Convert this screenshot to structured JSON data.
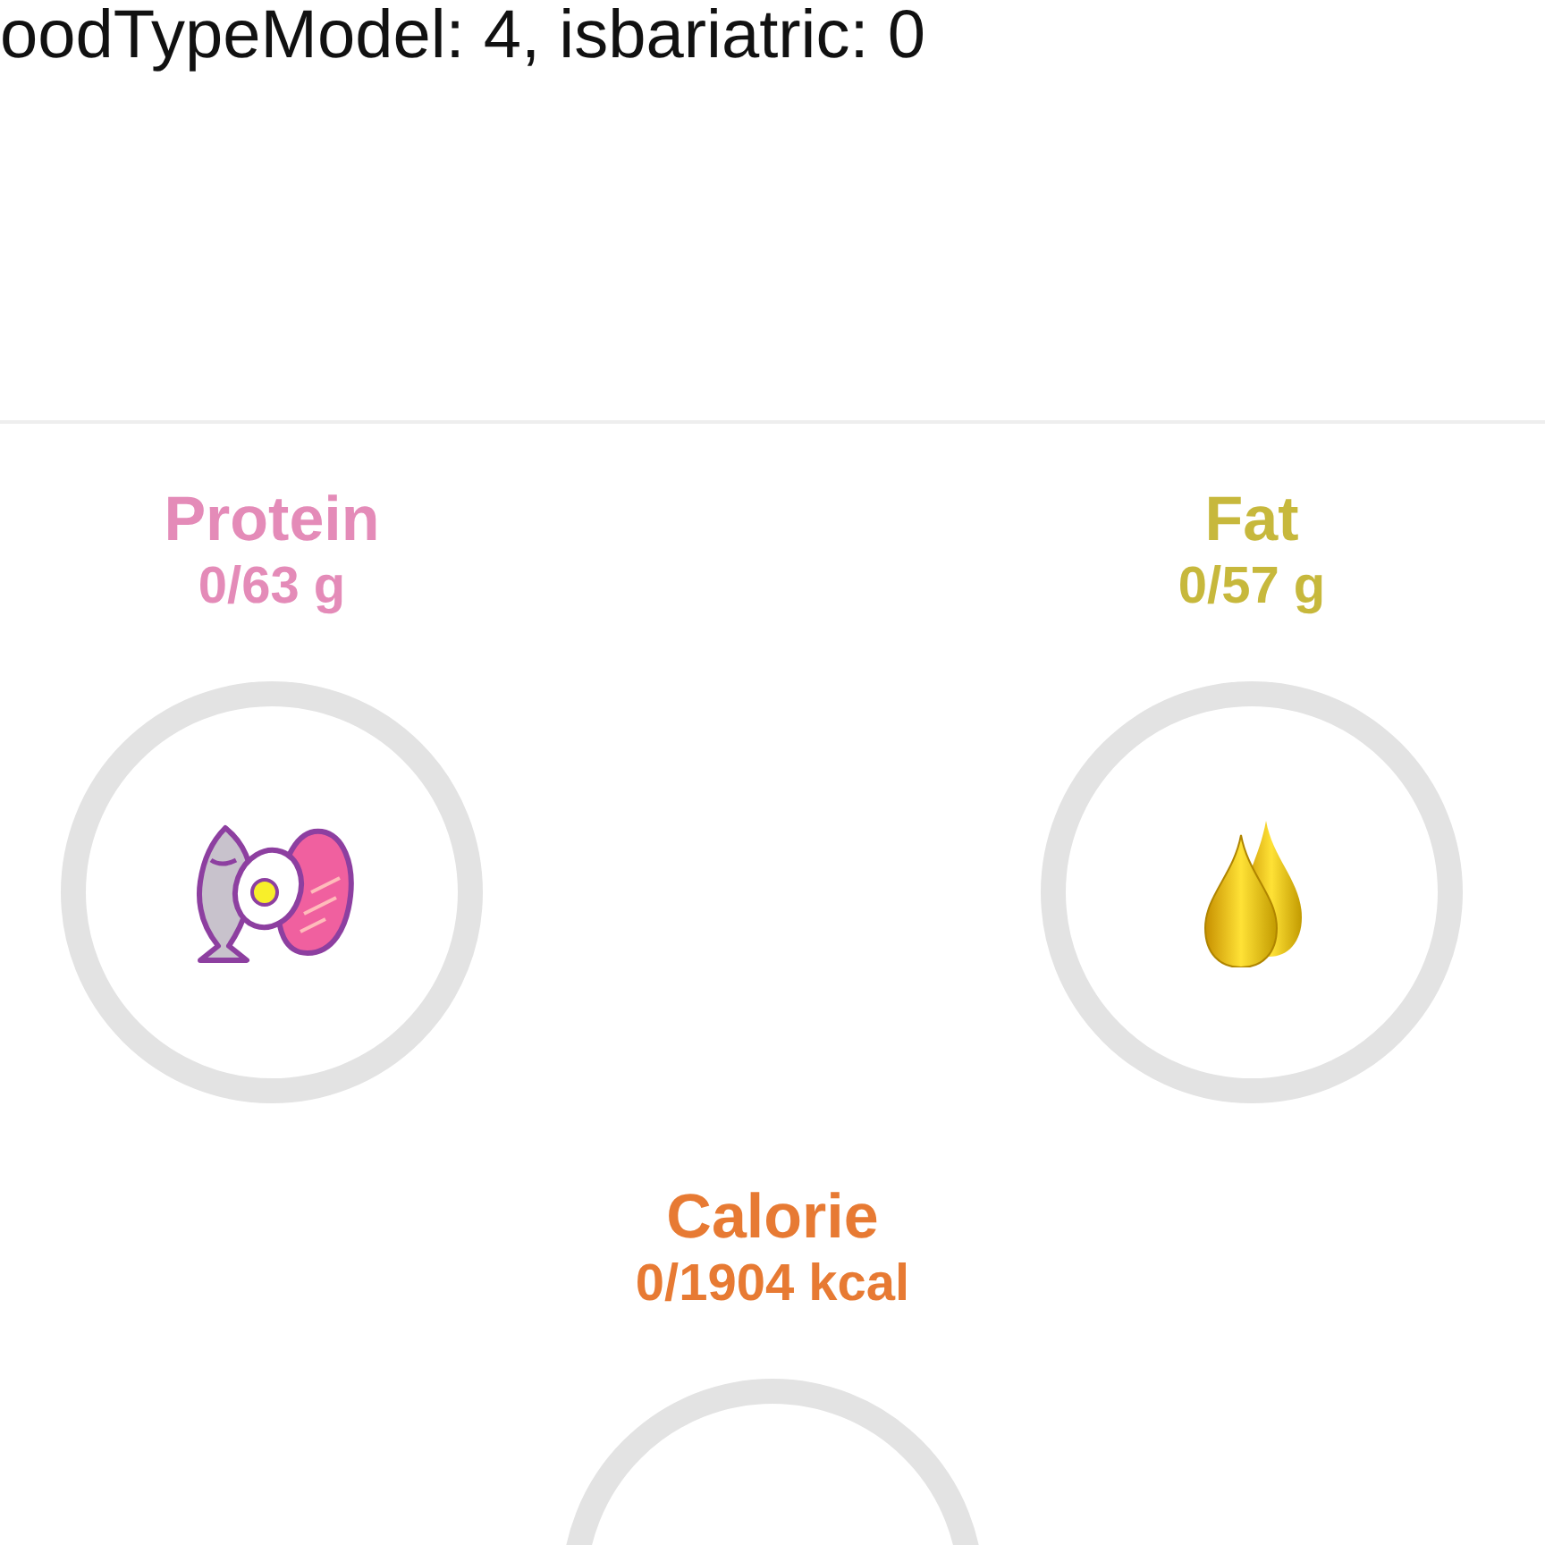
{
  "debug_text": "oodTypeModel: 4, isbariatric: 0",
  "macros": [
    {
      "kind": "protein",
      "title": "Protein",
      "value": "0/63 g",
      "color": "#e48bb8"
    },
    {
      "kind": "fat",
      "title": "Fat",
      "value": "0/57 g",
      "color": "#c7b83c"
    },
    {
      "kind": "calorie",
      "title": "Calorie",
      "value": "0/1904 kcal",
      "color": "#e77a33"
    }
  ]
}
